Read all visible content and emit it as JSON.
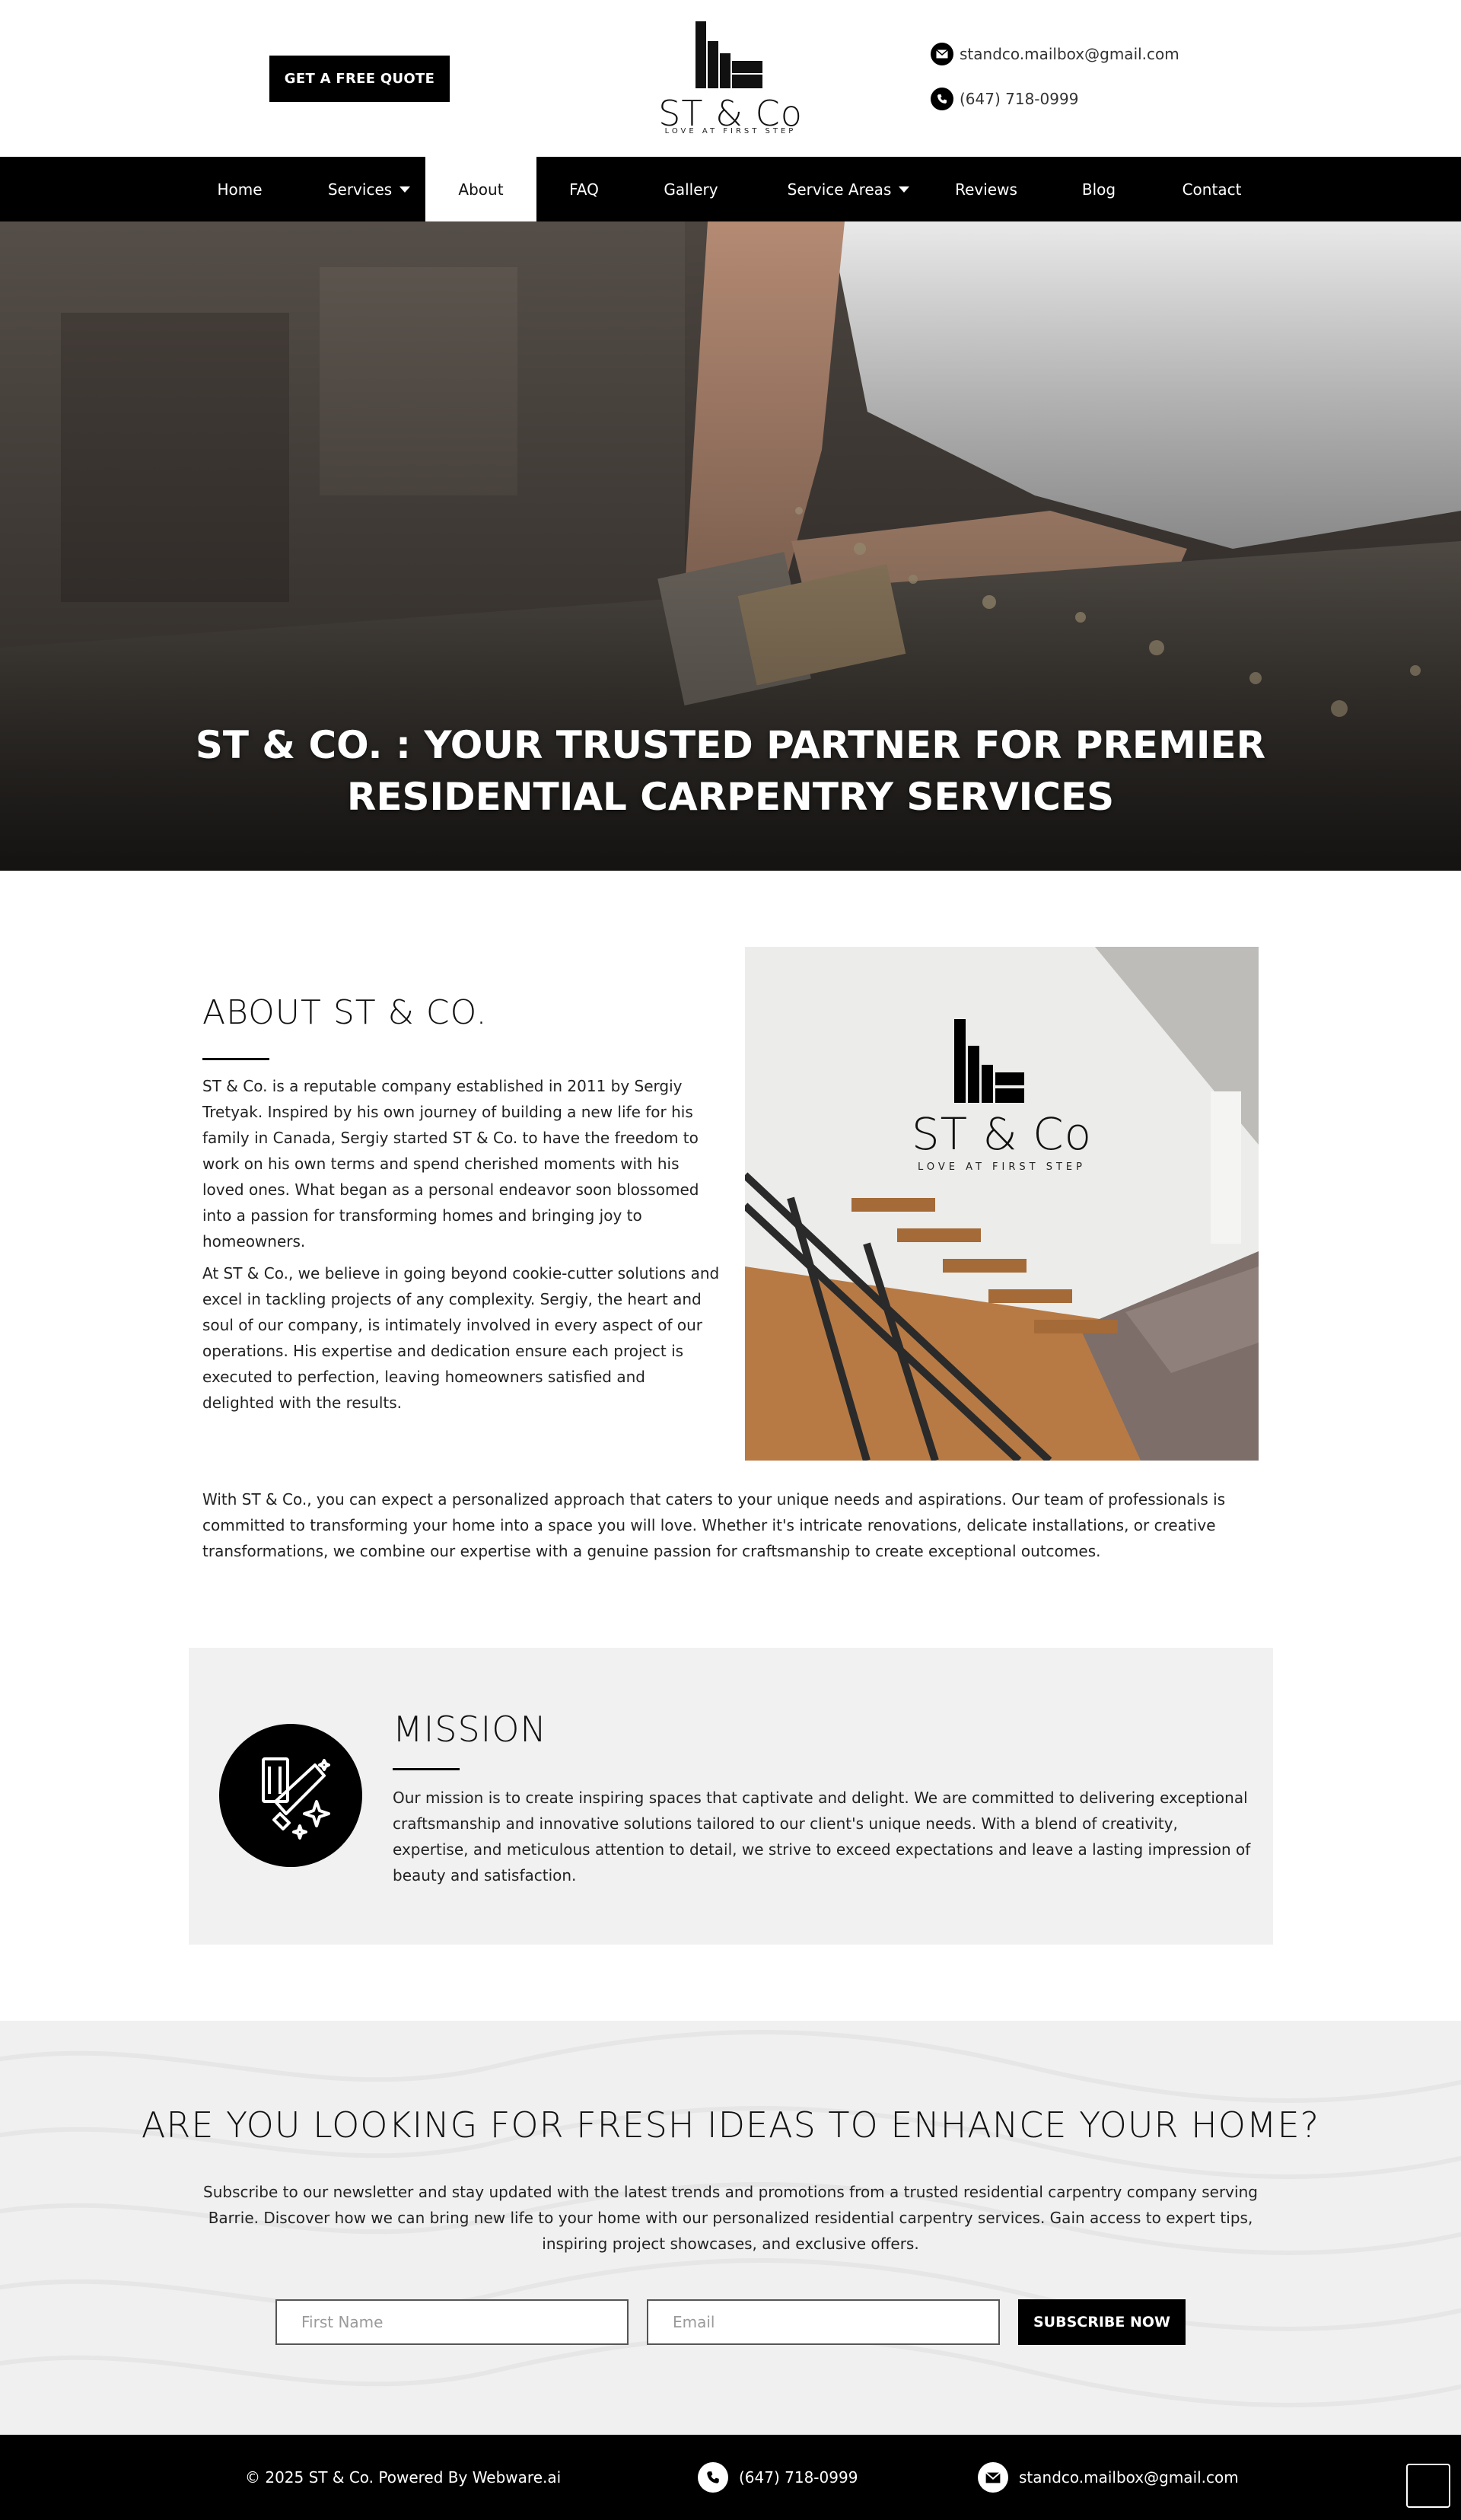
{
  "header": {
    "quote_button": "GET A FREE QUOTE",
    "logo_text": "ST & Co",
    "logo_tagline": "LOVE AT FIRST STEP",
    "email": "standco.mailbox@gmail.com",
    "phone": "(647) 718-0999"
  },
  "nav": {
    "items": [
      {
        "label": "Home"
      },
      {
        "label": "Services",
        "dropdown": true
      },
      {
        "label": "About",
        "active": true
      },
      {
        "label": "FAQ"
      },
      {
        "label": "Gallery"
      },
      {
        "label": "Service Areas",
        "dropdown": true
      },
      {
        "label": "Reviews"
      },
      {
        "label": "Blog"
      },
      {
        "label": "Contact"
      }
    ]
  },
  "hero": {
    "title_line1": "ST & CO. : YOUR TRUSTED PARTNER FOR PREMIER",
    "title_line2": "RESIDENTIAL CARPENTRY SERVICES"
  },
  "about": {
    "heading": "ABOUT ST & CO.",
    "para1": "ST & Co. is a reputable company established in 2011 by Sergiy Tretyak. Inspired by his own journey of building a new life for his family in Canada, Sergiy started ST & Co. to have the freedom to work on his own terms and spend cherished moments with his loved ones. What began as a personal endeavor soon blossomed into a passion for transforming homes and bringing joy to homeowners.",
    "para2": "At ST & Co., we believe in going beyond cookie-cutter solutions and excel in tackling projects of any complexity. Sergiy, the heart and soul of our company, is intimately involved in every aspect of our operations. His expertise and dedication ensure each project is executed to perfection, leaving homeowners satisfied and delighted with the results.",
    "para3": "With ST & Co., you can expect a personalized approach that caters to your unique needs and aspirations. Our team of professionals is committed to transforming your home into a space you will love. Whether it's intricate renovations, delicate installations, or creative transformations, we combine our expertise with a genuine passion for craftsmanship to create exceptional outcomes.",
    "photo_logo_text": "ST & Co",
    "photo_logo_tagline": "LOVE AT FIRST STEP"
  },
  "mission": {
    "heading": "MISSION",
    "text": "Our mission is to create inspiring spaces that captivate and delight. We are committed to delivering exceptional craftsmanship and innovative solutions tailored to our client's unique needs. With a blend of creativity, expertise, and meticulous attention to detail, we strive to exceed expectations and leave a lasting impression of beauty and satisfaction.",
    "icon": "saw-icon"
  },
  "newsletter": {
    "heading": "ARE YOU LOOKING FOR FRESH IDEAS TO ENHANCE YOUR HOME?",
    "text": "Subscribe to our newsletter and stay updated with the latest trends and promotions from a trusted residential carpentry company serving Barrie. Discover how we can bring new life to your home with our personalized residential carpentry services. Gain access to expert tips, inspiring project showcases, and exclusive offers.",
    "first_name_placeholder": "First Name",
    "email_placeholder": "Email",
    "subscribe_button": "SUBSCRIBE NOW"
  },
  "footer": {
    "copyright": "© 2025 ST & Co. Powered By Webware.ai",
    "phone": "(647) 718-0999",
    "email": "standco.mailbox@gmail.com"
  },
  "colors": {
    "primary": "#000000",
    "background": "#ffffff",
    "panel": "#f1f1f1"
  }
}
